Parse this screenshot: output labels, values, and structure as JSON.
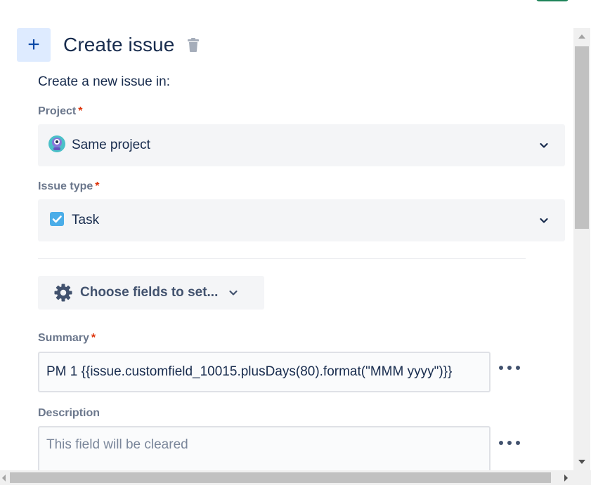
{
  "header": {
    "add_icon_glyph": "+",
    "title": "Create issue"
  },
  "intro": "Create a new issue in:",
  "project": {
    "label": "Project",
    "required_mark": "*",
    "value": "Same project",
    "icon": "project-avatar-icon"
  },
  "issue_type": {
    "label": "Issue type",
    "required_mark": "*",
    "value": "Task",
    "icon": "task-checkbox-icon"
  },
  "choose_fields": {
    "label": "Choose fields to set..."
  },
  "summary": {
    "label": "Summary",
    "required_mark": "*",
    "value": "PM 1 {{issue.customfield_10015.plusDays(80).format(\"MMM yyyy\")}}"
  },
  "description": {
    "label": "Description",
    "placeholder": "This field will be cleared"
  },
  "colors": {
    "accent": "#0052cc",
    "required": "#de350b",
    "label": "#6b778c",
    "field_bg": "#f4f5f7",
    "task_icon": "#4bade8"
  }
}
